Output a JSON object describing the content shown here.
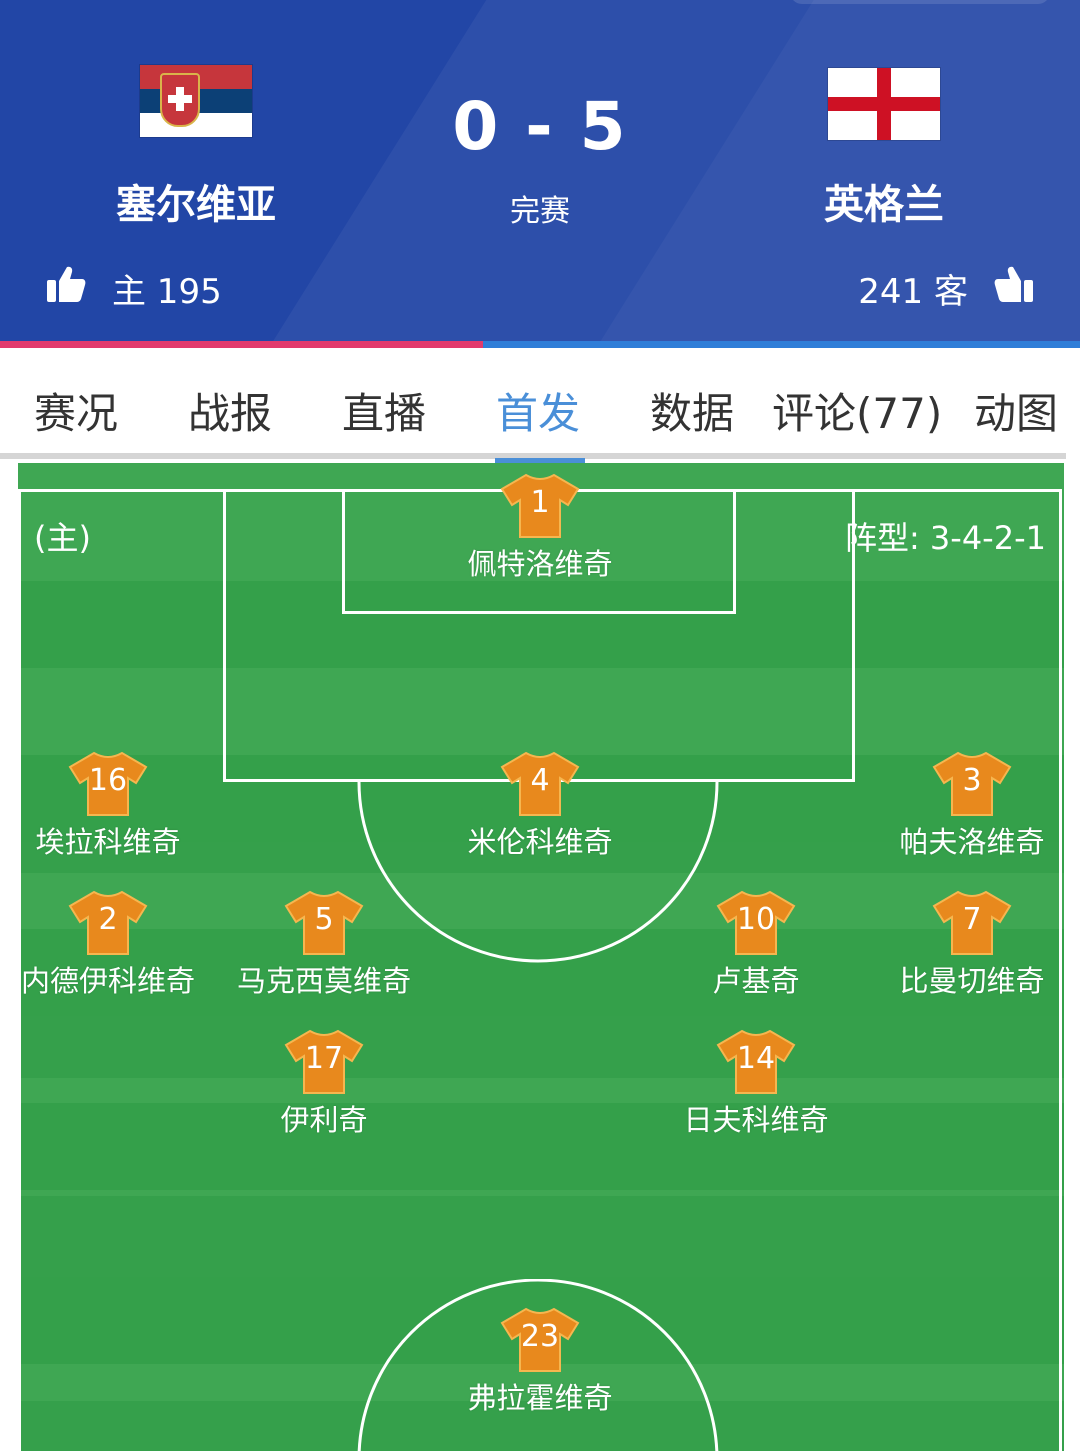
{
  "match": {
    "home_team": "塞尔维亚",
    "away_team": "英格兰",
    "score": "0 - 5",
    "status": "完赛",
    "home_vote_label": "主 195",
    "away_vote_label": "241 客",
    "home_vote_count": 195,
    "away_vote_count": 241
  },
  "tabs": [
    "赛况",
    "战报",
    "直播",
    "首发",
    "数据",
    "评论(77)",
    "动图"
  ],
  "active_tab": "首发",
  "lineup": {
    "side_label": "(主)",
    "formation_label": "阵型: 3-4-2-1",
    "players": [
      {
        "number": "1",
        "name": "佩特洛维奇"
      },
      {
        "number": "16",
        "name": "埃拉科维奇"
      },
      {
        "number": "4",
        "name": "米伦科维奇"
      },
      {
        "number": "3",
        "name": "帕夫洛维奇"
      },
      {
        "number": "2",
        "name": "内德伊科维奇"
      },
      {
        "number": "5",
        "name": "马克西莫维奇"
      },
      {
        "number": "10",
        "name": "卢基奇"
      },
      {
        "number": "7",
        "name": "比曼切维奇"
      },
      {
        "number": "17",
        "name": "伊利奇"
      },
      {
        "number": "14",
        "name": "日夫科维奇"
      },
      {
        "number": "23",
        "name": "弗拉霍维奇"
      }
    ]
  },
  "colors": {
    "header_bg": "#2246a6",
    "home_support": "#e23a6d",
    "away_support": "#2f7ed8",
    "active_tab": "#4a8fd8",
    "shirt": "#e8891d",
    "pitch_light": "#3fa753",
    "pitch_dark": "#34a04a"
  },
  "icons": {
    "home_vote": "thumbs-up-icon",
    "away_vote": "thumbs-up-icon",
    "shirt": "jersey-icon"
  }
}
